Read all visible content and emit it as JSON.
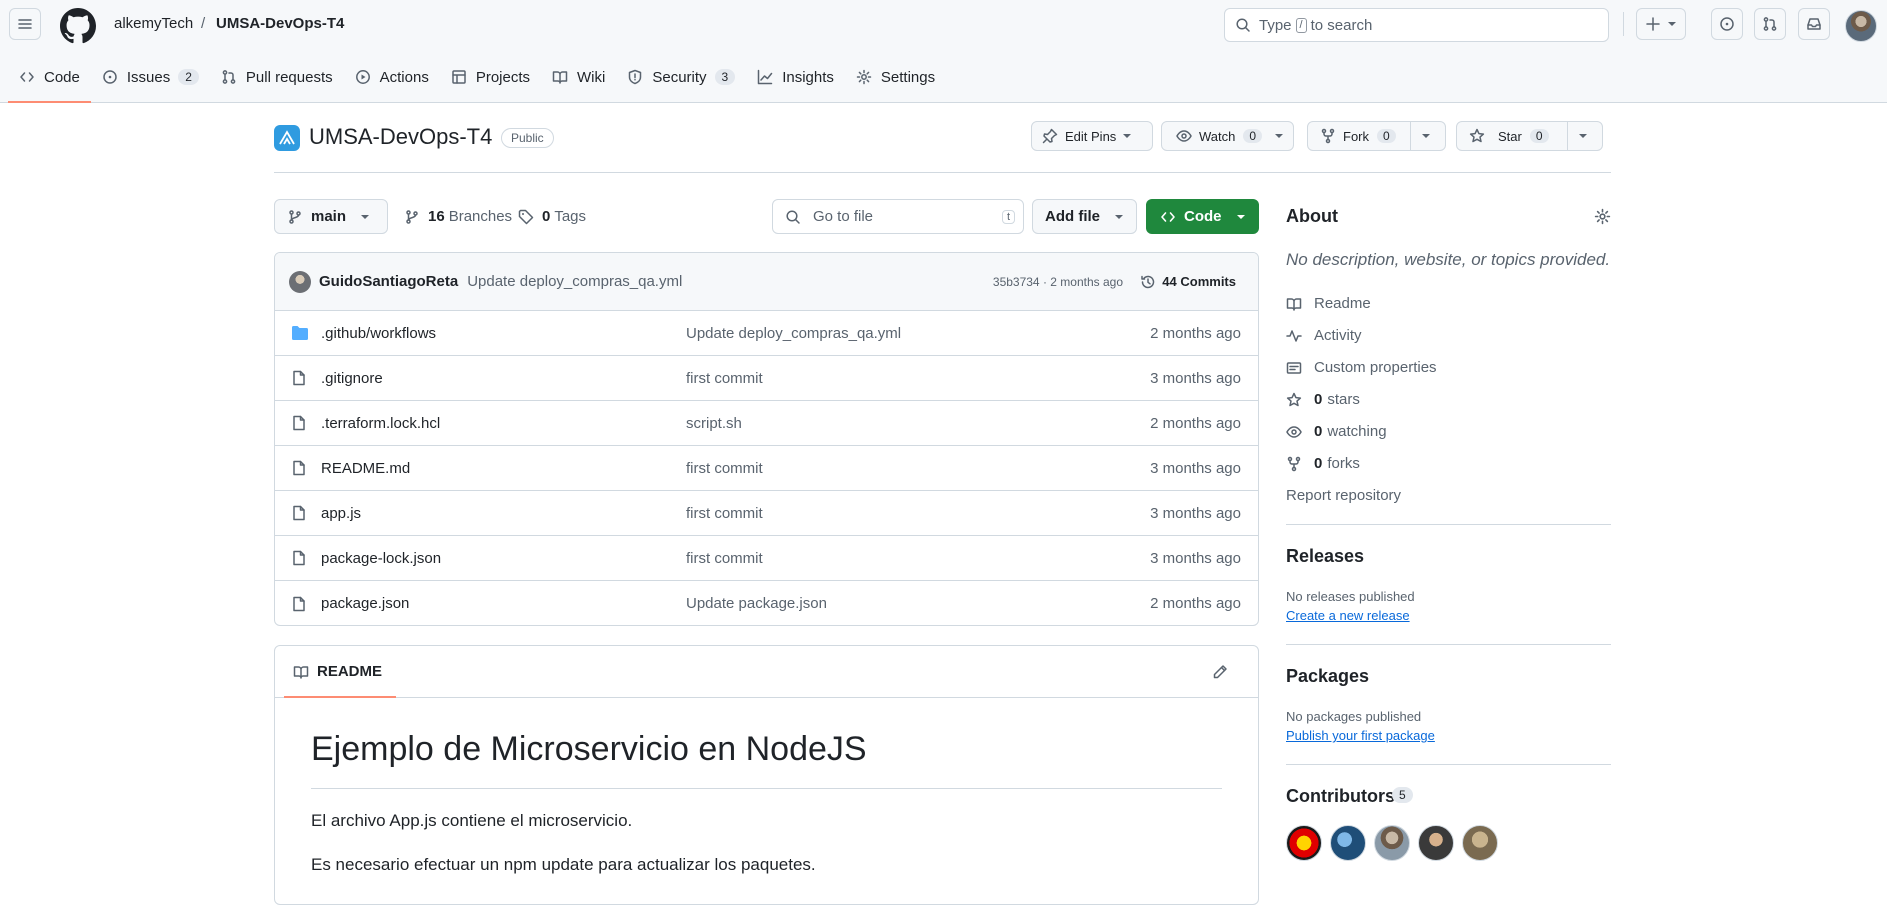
{
  "header": {
    "owner": "alkemyTech",
    "separator": "/",
    "repo": "UMSA-DevOps-T4",
    "search_before": "Type",
    "search_key": "/",
    "search_after": "to search"
  },
  "tabs": [
    {
      "label": "Code",
      "icon": "code-icon",
      "active": true
    },
    {
      "label": "Issues",
      "count": "2",
      "icon": "issue-icon"
    },
    {
      "label": "Pull requests",
      "icon": "pull-request-icon"
    },
    {
      "label": "Actions",
      "icon": "play-icon"
    },
    {
      "label": "Projects",
      "icon": "table-icon"
    },
    {
      "label": "Wiki",
      "icon": "book-icon"
    },
    {
      "label": "Security",
      "count": "3",
      "icon": "shield-icon"
    },
    {
      "label": "Insights",
      "icon": "graph-icon"
    },
    {
      "label": "Settings",
      "icon": "gear-icon"
    }
  ],
  "repo_header": {
    "name": "UMSA-DevOps-T4",
    "visibility": "Public",
    "edit_pins": "Edit Pins",
    "watch": "Watch",
    "watch_count": "0",
    "fork": "Fork",
    "fork_count": "0",
    "star": "Star",
    "star_count": "0"
  },
  "file_nav": {
    "branch": "main",
    "branches_count": "16",
    "branches_label": "Branches",
    "tags_count": "0",
    "tags_label": "Tags",
    "go_to_file": "Go to file",
    "go_to_file_key": "t",
    "add_file": "Add file",
    "code": "Code"
  },
  "latest_commit": {
    "author": "GuidoSantiagoReta",
    "message": "Update deploy_compras_qa.yml",
    "sha_time": "35b3734 · 2 months ago",
    "commits": "44 Commits"
  },
  "files": [
    {
      "name": ".github/workflows",
      "type": "folder",
      "message": "Update deploy_compras_qa.yml",
      "date": "2 months ago"
    },
    {
      "name": ".gitignore",
      "type": "file",
      "message": "first commit",
      "date": "3 months ago"
    },
    {
      "name": ".terraform.lock.hcl",
      "type": "file",
      "message": "script.sh",
      "date": "2 months ago"
    },
    {
      "name": "README.md",
      "type": "file",
      "message": "first commit",
      "date": "3 months ago"
    },
    {
      "name": "app.js",
      "type": "file",
      "message": "first commit",
      "date": "3 months ago"
    },
    {
      "name": "package-lock.json",
      "type": "file",
      "message": "first commit",
      "date": "3 months ago"
    },
    {
      "name": "package.json",
      "type": "file",
      "message": "Update package.json",
      "date": "2 months ago"
    }
  ],
  "readme": {
    "tab_label": "README",
    "title": "Ejemplo de Microservicio en NodeJS",
    "p1": "El archivo App.js contiene el microservicio.",
    "p2": "Es necesario efectuar un npm update para actualizar los paquetes."
  },
  "sidebar": {
    "about_title": "About",
    "about_desc": "No description, website, or topics provided.",
    "readme": "Readme",
    "activity": "Activity",
    "custom_properties": "Custom properties",
    "stars_count": "0",
    "stars_label": "stars",
    "watching_count": "0",
    "watching_label": "watching",
    "forks_count": "0",
    "forks_label": "forks",
    "report": "Report repository",
    "releases_title": "Releases",
    "releases_none": "No releases published",
    "releases_link": "Create a new release",
    "packages_title": "Packages",
    "packages_none": "No packages published",
    "packages_link": "Publish your first package",
    "contributors_title": "Contributors",
    "contributors_count": "5"
  },
  "colors": {
    "accent_underline": "#fd8c73",
    "code_button": "#1f883d",
    "link": "#0969da",
    "folder": "#54aeff"
  }
}
